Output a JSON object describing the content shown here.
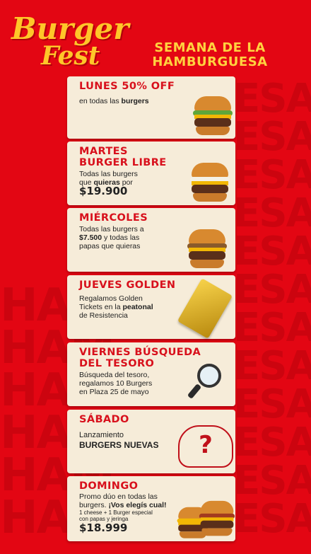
{
  "brand": {
    "word1": "Burger",
    "word2": "Fest"
  },
  "headline": {
    "line1": "SEMANA DE LA",
    "line2": "HAMBURGUESA"
  },
  "background_words": [
    "ESA",
    "HAM"
  ],
  "days": [
    {
      "title": "LUNES 50% OFF",
      "text1": "en todas las ",
      "bold1": "burgers"
    },
    {
      "title_l1": "MARTES",
      "title_l2": "BURGER LIBRE",
      "text1": "Todas las burgers",
      "text2a": "que ",
      "bold2": "quieras",
      "text2b": " por",
      "price": "$19.900"
    },
    {
      "title": "MIÉRCOLES",
      "text1": "Todas las burgers a",
      "bold2": "$7.500",
      "text2": " y todas las",
      "text3": "papas que quieras"
    },
    {
      "title": "JUEVES GOLDEN",
      "text1": "Regalamos Golden",
      "text2a": "Tickets en la ",
      "bold2": "peatonal",
      "text3": "de Resistencia"
    },
    {
      "title_l1": "VIERNES BÚSQUEDA",
      "title_l2": "DEL TESORO",
      "text1": "Búsqueda del tesoro,",
      "text2": "regalamos 10 Burgers",
      "text3": "en Plaza 25 de mayo"
    },
    {
      "title": "SÁBADO",
      "text1": "Lanzamiento",
      "bold2": "BURGERS NUEVAS",
      "icon": "?"
    },
    {
      "title": "DOMINGO",
      "text1": "Promo dúo en todas las",
      "text2a": "burgers. ",
      "bold2": "¡Vos elegís cual!",
      "text3": "1 cheese + 1 Burger especial",
      "text4": "con papas y jeringa",
      "price": "$18.999"
    }
  ],
  "colors": {
    "background": "#e30613",
    "card": "#f6ecd9",
    "title_red": "#d8101c",
    "accent_yellow": "#ffd23f"
  }
}
